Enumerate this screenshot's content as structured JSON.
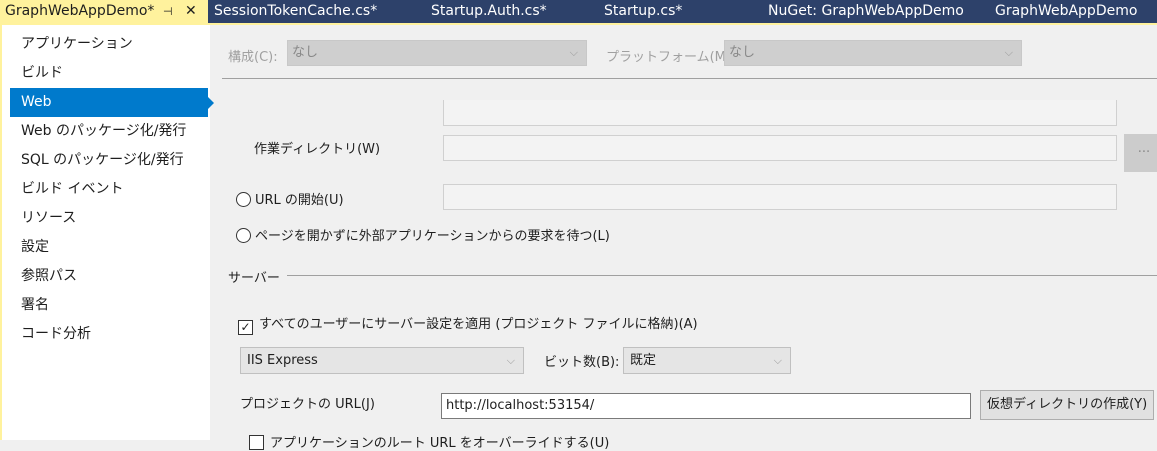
{
  "tabs": [
    {
      "label": "GraphWebAppDemo*",
      "active": true
    },
    {
      "label": "SessionTokenCache.cs*"
    },
    {
      "label": "Startup.Auth.cs*"
    },
    {
      "label": "Startup.cs*"
    },
    {
      "label": "NuGet: GraphWebAppDemo"
    },
    {
      "label": "GraphWebAppDemo"
    }
  ],
  "tab_icons": {
    "pin": "⊣",
    "close": "✕"
  },
  "sidebar": {
    "items": [
      {
        "label": "アプリケーション"
      },
      {
        "label": "ビルド"
      },
      {
        "label": "Web",
        "selected": true
      },
      {
        "label": "Web のパッケージ化/発行"
      },
      {
        "label": "SQL のパッケージ化/発行"
      },
      {
        "label": "ビルド イベント"
      },
      {
        "label": "リソース"
      },
      {
        "label": "設定"
      },
      {
        "label": "参照パス"
      },
      {
        "label": "署名"
      },
      {
        "label": "コード分析"
      }
    ]
  },
  "config": {
    "label": "構成(C):",
    "value": "なし",
    "platform_label": "プラットフォーム(M):",
    "platform_value": "なし"
  },
  "start": {
    "workdir_label": "作業ディレクトリ(W)",
    "browse": "...",
    "url_label": "URL の開始(U)",
    "wait_label": "ページを開かずに外部アプリケーションからの要求を待つ(L)"
  },
  "server": {
    "section": "サーバー",
    "apply_all_label": "すべてのユーザーにサーバー設定を適用 (プロジェクト ファイルに格納)(A)",
    "apply_all_checked": true,
    "server_value": "IIS Express",
    "bits_label": "ビット数(B):",
    "bits_value": "既定",
    "project_url_label": "プロジェクトの URL(J)",
    "project_url_value": "http://localhost:53154/",
    "create_vdir": "仮想ディレクトリの作成(Y)",
    "override_label": "アプリケーションのルート URL をオーバーライドする(U)"
  }
}
